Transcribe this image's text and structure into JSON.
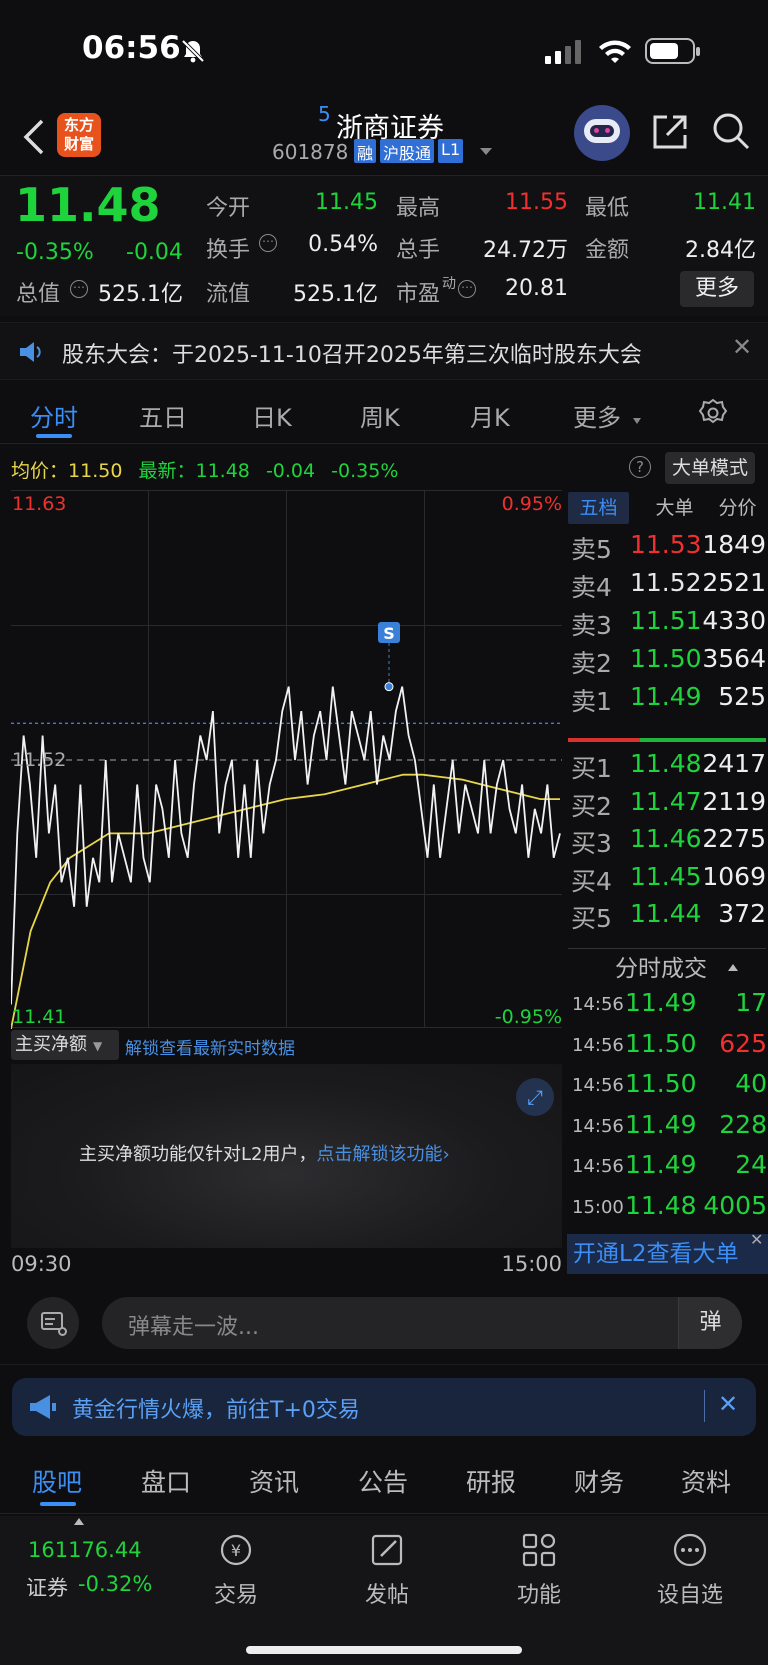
{
  "status": {
    "time": "06:56"
  },
  "header": {
    "logo_line1": "东方",
    "logo_line2": "财富",
    "badge": "5",
    "title": "浙商证券",
    "code": "601878",
    "tags": [
      "融",
      "沪股通",
      "L1"
    ]
  },
  "quote": {
    "price": "11.48",
    "change_pct": "-0.35%",
    "change": "-0.04",
    "open_label": "今开",
    "open": "11.45",
    "high_label": "最高",
    "high": "11.55",
    "low_label": "最低",
    "low": "11.41",
    "turnover_label": "换手",
    "turnover": "0.54%",
    "volume_label": "总手",
    "volume": "24.72万",
    "amount_label": "金额",
    "amount": "2.84亿",
    "mktcap_label": "总值",
    "mktcap": "525.1亿",
    "float_label": "流值",
    "float": "525.1亿",
    "pe_label": "市盈",
    "pe_sup": "动",
    "pe": "20.81",
    "more": "更多"
  },
  "notice": {
    "text": "股东大会：于2025-11-10召开2025年第三次临时股东大会"
  },
  "tabs": [
    "分时",
    "五日",
    "日K",
    "周K",
    "月K",
    "更多"
  ],
  "avg_bar": {
    "avg_label": "均价：",
    "avg": "11.50",
    "latest_label": "最新：",
    "latest": "11.48",
    "chg": "-0.04",
    "pct": "-0.35%",
    "bigmode": "大单模式"
  },
  "chart": {
    "y_top": "11.63",
    "y_mid": "11.52",
    "y_bottom": "11.41",
    "pct_top": "0.95%",
    "pct_bottom": "-0.95%",
    "x_start": "09:30",
    "x_end": "15:00",
    "marker": "S"
  },
  "chart_data": {
    "type": "line",
    "x_range": [
      "09:30",
      "15:00"
    ],
    "ylim": [
      11.41,
      11.63
    ],
    "prev_close": 11.52,
    "series": [],
    "price": [
      11.42,
      11.49,
      11.53,
      11.51,
      11.48,
      11.53,
      11.49,
      11.51,
      11.47,
      11.48,
      11.46,
      11.51,
      11.46,
      11.48,
      11.47,
      11.52,
      11.47,
      11.49,
      11.48,
      11.47,
      11.51,
      11.48,
      11.47,
      11.51,
      11.5,
      11.48,
      11.52,
      11.49,
      11.48,
      11.51,
      11.53,
      11.52,
      11.54,
      11.49,
      11.51,
      11.52,
      11.48,
      11.51,
      11.48,
      11.52,
      11.49,
      11.51,
      11.52,
      11.54,
      11.55,
      11.52,
      11.54,
      11.51,
      11.53,
      11.54,
      11.52,
      11.55,
      11.53,
      11.51,
      11.54,
      11.53,
      11.52,
      11.54,
      11.51,
      11.53,
      11.52,
      11.54,
      11.55,
      11.53,
      11.52,
      11.5,
      11.48,
      11.51,
      11.48,
      11.5,
      11.52,
      11.49,
      11.51,
      11.5,
      11.49,
      11.52,
      11.49,
      11.51,
      11.52,
      11.5,
      11.49,
      11.51,
      11.48,
      11.5,
      11.49,
      11.51,
      11.48,
      11.49
    ],
    "avg": [
      11.41,
      11.45,
      11.47,
      11.48,
      11.485,
      11.49,
      11.49,
      11.49,
      11.492,
      11.494,
      11.496,
      11.498,
      11.5,
      11.502,
      11.504,
      11.505,
      11.506,
      11.508,
      11.51,
      11.512,
      11.514,
      11.514,
      11.513,
      11.512,
      11.51,
      11.508,
      11.506,
      11.504,
      11.504
    ]
  },
  "book": {
    "tabs": [
      "五档",
      "大单",
      "分价"
    ],
    "sell": [
      {
        "label": "卖5",
        "price": "11.53",
        "vol": "1849"
      },
      {
        "label": "卖4",
        "price": "11.52",
        "vol": "2521"
      },
      {
        "label": "卖3",
        "price": "11.51",
        "vol": "4330"
      },
      {
        "label": "卖2",
        "price": "11.50",
        "vol": "3564"
      },
      {
        "label": "卖1",
        "price": "11.49",
        "vol": "525"
      }
    ],
    "buy": [
      {
        "label": "买1",
        "price": "11.48",
        "vol": "2417"
      },
      {
        "label": "买2",
        "price": "11.47",
        "vol": "2119"
      },
      {
        "label": "买3",
        "price": "11.46",
        "vol": "2275"
      },
      {
        "label": "买4",
        "price": "11.45",
        "vol": "1069"
      },
      {
        "label": "买5",
        "price": "11.44",
        "vol": "372"
      }
    ],
    "trades_title": "分时成交",
    "trades": [
      {
        "t": "14:56",
        "p": "11.49",
        "v": "17"
      },
      {
        "t": "14:56",
        "p": "11.50",
        "v": "625"
      },
      {
        "t": "14:56",
        "p": "11.50",
        "v": "40"
      },
      {
        "t": "14:56",
        "p": "11.49",
        "v": "228"
      },
      {
        "t": "14:56",
        "p": "11.49",
        "v": "24"
      },
      {
        "t": "15:00",
        "p": "11.48",
        "v": "4005"
      }
    ],
    "l2_promo": "开通L2查看大单"
  },
  "mainbuy": {
    "label": "主买净额",
    "unlock_link": "解锁查看最新实时数据",
    "msg": "主买净额功能仅针对L2用户，",
    "msg_link": "点击解锁该功能"
  },
  "danmu": {
    "placeholder": "弹幕走一波..."
  },
  "banner": {
    "text": "黄金行情火爆，前往T+0交易"
  },
  "subtabs": [
    "股吧",
    "盘口",
    "资讯",
    "公告",
    "研报",
    "财务",
    "资料"
  ],
  "bottom_nav": {
    "index_value": "161176.44",
    "index_name": "证券",
    "index_pct": "-0.32%",
    "items": [
      "交易",
      "发帖",
      "功能",
      "设自选"
    ]
  }
}
